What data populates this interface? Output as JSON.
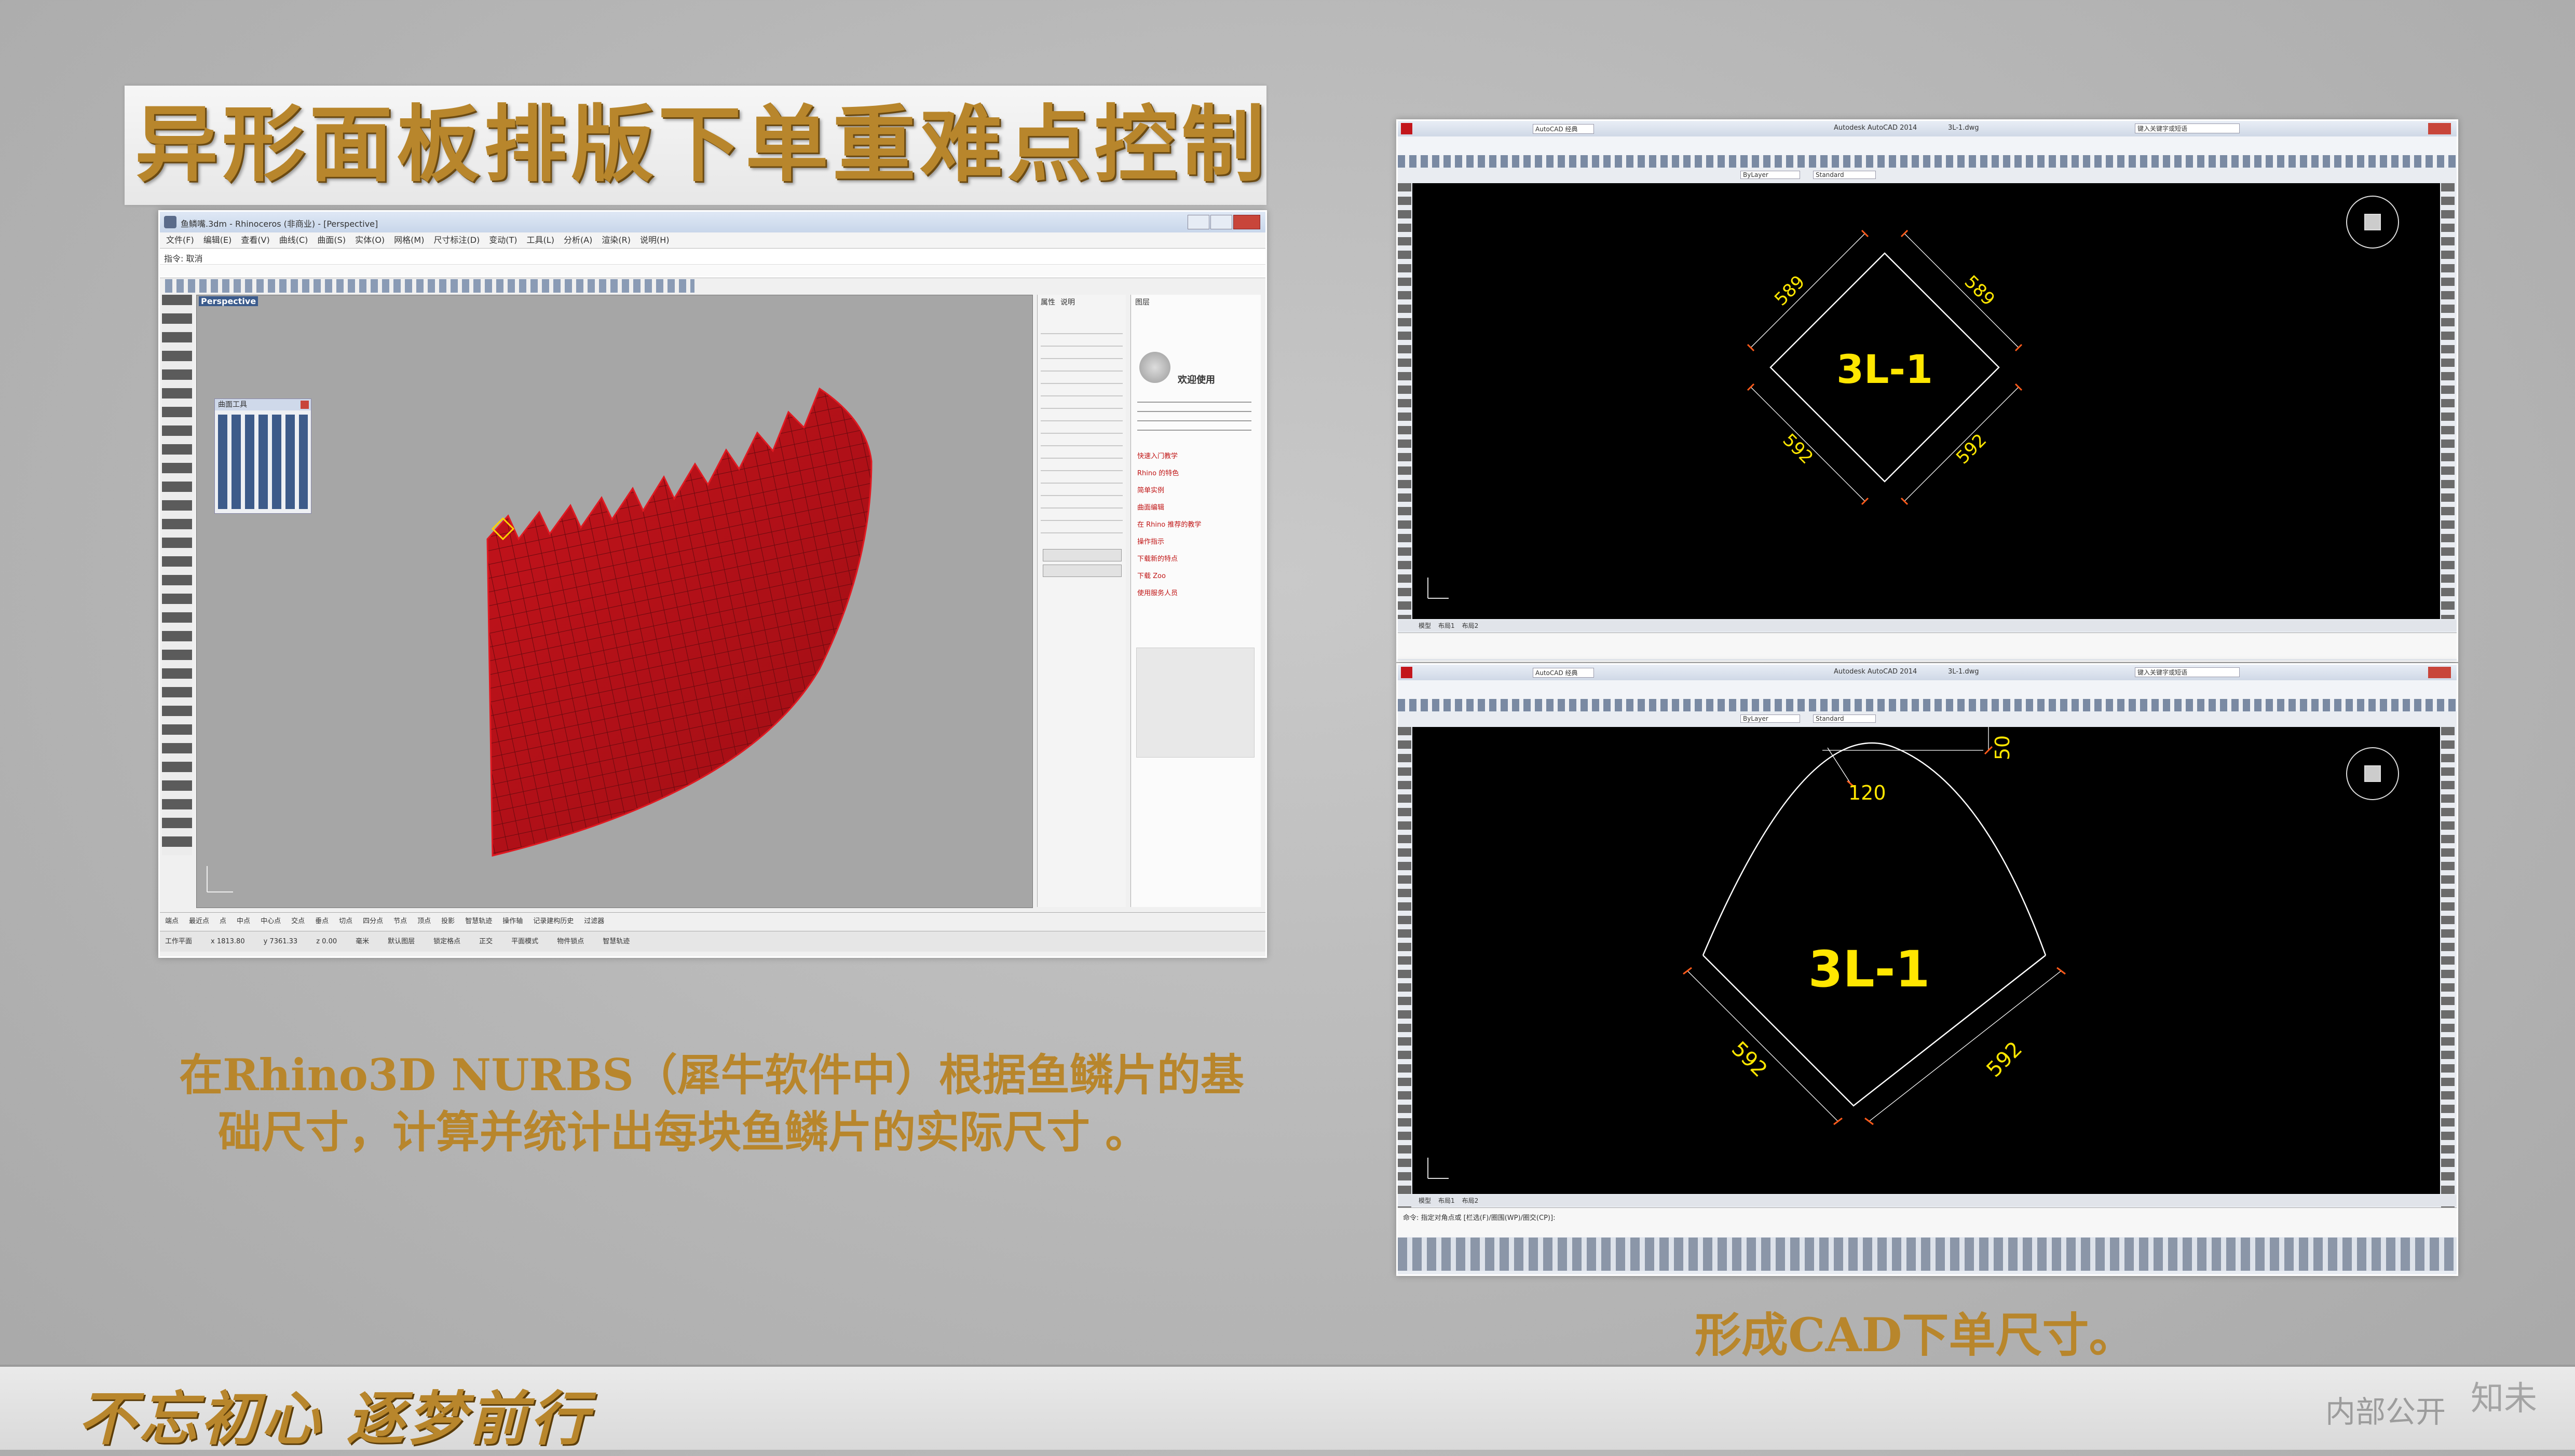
{
  "title": "异形面板排版下单重难点控制",
  "rhino": {
    "window_title": "鱼鳞嘴.3dm - Rhinoceros (非商业) - [Perspective]",
    "menu": [
      "文件(F)",
      "编辑(E)",
      "查看(V)",
      "曲线(C)",
      "曲面(S)",
      "实体(O)",
      "网格(M)",
      "尺寸标注(D)",
      "变动(T)",
      "工具(L)",
      "分析(A)",
      "渲染(R)",
      "说明(H)"
    ],
    "command_prompt": "指令: 取消",
    "viewport_label": "Perspective",
    "toolbox_title": "曲面工具",
    "panel_tabs": [
      "属性",
      "说明"
    ],
    "right_panel_tab": "图层",
    "welcome_title": "欢迎使用",
    "red_links": [
      "快速入门教学",
      "Rhino 的特色",
      "简单实例",
      "曲面编辑",
      "在 Rhino 推荐的教学",
      "操作指示",
      "下载新的特点",
      "下载 Zoo",
      "使用服务人员"
    ],
    "osnap": [
      "端点",
      "最近点",
      "点",
      "中点",
      "中心点",
      "交点",
      "垂点",
      "切点",
      "四分点",
      "节点",
      "顶点",
      "投影",
      "智慧轨迹",
      "操作轴",
      "记录建构历史",
      "过滤器"
    ],
    "status": [
      "工作平面",
      "x 1813.80",
      "y 7361.33",
      "z 0.00",
      "毫米",
      "默认图层",
      "锁定格点",
      "正交",
      "平面模式",
      "物件锁点",
      "智慧轨迹"
    ]
  },
  "cad": {
    "app_title": "Autodesk AutoCAD 2014",
    "file_name": "3L-1.dwg",
    "workspace": "AutoCAD 经典",
    "search_placeholder": "键入关键字或短语",
    "layer": "ByLayer",
    "style": "Standard",
    "top": {
      "label": "3L-1",
      "dims": [
        "589",
        "589",
        "592",
        "592"
      ]
    },
    "bottom": {
      "label": "3L-1",
      "dims": [
        "120",
        "50",
        "592",
        "592"
      ]
    },
    "model_tabs": [
      "模型",
      "布局1",
      "布局2"
    ],
    "command_text": "命令: 指定对角点或 [栏选(F)/圈围(WP)/圈交(CP)]:"
  },
  "captions": {
    "rhino_line1": "在Rhino3D NURBS（犀牛软件中）根据鱼鳞片的基",
    "rhino_line2": "础尺寸，计算并统计出每块鱼鳞片的实际尺寸 。",
    "cad": "形成CAD下单尺寸。"
  },
  "footer": {
    "slogan": "不忘初心  逐梦前行",
    "internal": "内部公开",
    "watermark": "知未"
  },
  "colors": {
    "gold": "#b8862c",
    "mesh_red": "#b3121a",
    "cad_yellow": "#ffe600",
    "cad_bg": "#000000"
  }
}
